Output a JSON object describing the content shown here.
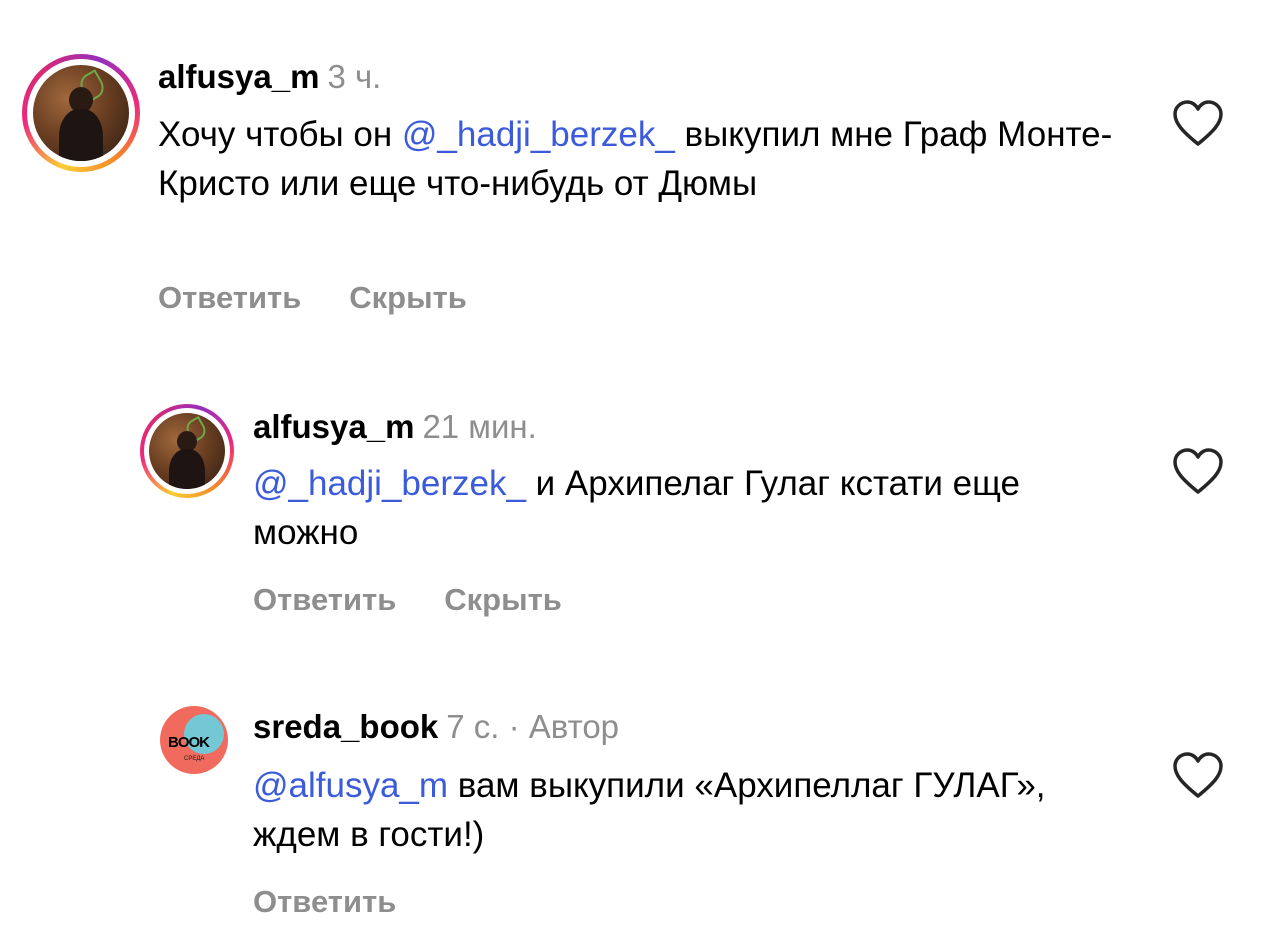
{
  "comments": [
    {
      "username": "alfusya_m",
      "time": "3 ч.",
      "text_before": "Хочу чтобы он ",
      "mention": "@_hadji_berzek_",
      "text_after": " выкупил мне Граф Монте-Кристо или еще что-нибудь от Дюмы",
      "actions": [
        "Ответить",
        "Скрыть"
      ]
    },
    {
      "username": "alfusya_m",
      "time": "21 мин.",
      "text_before": "",
      "mention": "@_hadji_berzek_",
      "text_after": " и Архипелаг Гулаг кстати еще можно",
      "actions": [
        "Ответить",
        "Скрыть"
      ]
    },
    {
      "username": "sreda_book",
      "time": "7 с. · Автор",
      "text_before": "",
      "mention": "@alfusya_m",
      "text_after": " вам выкупили «Архипеллаг ГУЛАГ», ждем в гости!)",
      "actions": [
        "Ответить"
      ],
      "avatar_text": "BOOK",
      "avatar_subtext": "СРЕДА"
    }
  ],
  "icons": {
    "like": "heart-outline-icon"
  },
  "colors": {
    "mention": "#3b5bdb",
    "muted": "#8e8e8e"
  }
}
